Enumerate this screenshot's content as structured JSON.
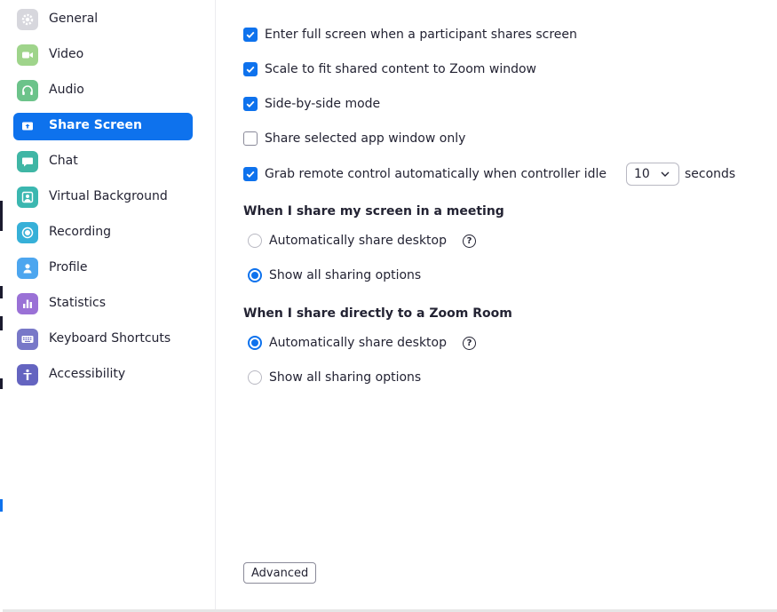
{
  "sidebar": {
    "items": [
      {
        "label": "General",
        "icon": "gear-icon",
        "color": "#d7d7dd",
        "active": false
      },
      {
        "label": "Video",
        "icon": "video-camera-icon",
        "color": "#9fd48b",
        "active": false
      },
      {
        "label": "Audio",
        "icon": "headphones-icon",
        "color": "#6cc38a",
        "active": false
      },
      {
        "label": "Share Screen",
        "icon": "share-screen-icon",
        "color": "#0e72ed",
        "active": true
      },
      {
        "label": "Chat",
        "icon": "chat-bubble-icon",
        "color": "#3fb6a5",
        "active": false
      },
      {
        "label": "Virtual Background",
        "icon": "virtual-background-icon",
        "color": "#3bb7b0",
        "active": false
      },
      {
        "label": "Recording",
        "icon": "recording-icon",
        "color": "#36b0d8",
        "active": false
      },
      {
        "label": "Profile",
        "icon": "profile-icon",
        "color": "#4da6ef",
        "active": false
      },
      {
        "label": "Statistics",
        "icon": "statistics-icon",
        "color": "#9a71d6",
        "active": false
      },
      {
        "label": "Keyboard Shortcuts",
        "icon": "keyboard-icon",
        "color": "#7878c8",
        "active": false
      },
      {
        "label": "Accessibility",
        "icon": "accessibility-icon",
        "color": "#6464c0",
        "active": false
      }
    ]
  },
  "main": {
    "options": [
      {
        "label": "Enter full screen when a participant shares screen",
        "checked": true
      },
      {
        "label": "Scale to fit shared content to Zoom window",
        "checked": true
      },
      {
        "label": "Side-by-side mode",
        "checked": true
      },
      {
        "label": "Share selected app window only",
        "checked": false
      },
      {
        "label": "Grab remote control automatically when controller idle",
        "checked": true
      }
    ],
    "idle_select_value": "10",
    "idle_unit": "seconds",
    "meeting_section": {
      "title": "When I share my screen in a meeting",
      "options": [
        {
          "label": "Automatically share desktop",
          "selected": false,
          "help": "?"
        },
        {
          "label": "Show all sharing options",
          "selected": true
        }
      ]
    },
    "zoom_room_section": {
      "title": "When I share directly to a Zoom Room",
      "options": [
        {
          "label": "Automatically share desktop",
          "selected": true,
          "help": "?"
        },
        {
          "label": "Show all sharing options",
          "selected": false
        }
      ]
    },
    "advanced_button": "Advanced"
  },
  "colors": {
    "accent": "#0e72ed",
    "text": "#232333"
  }
}
